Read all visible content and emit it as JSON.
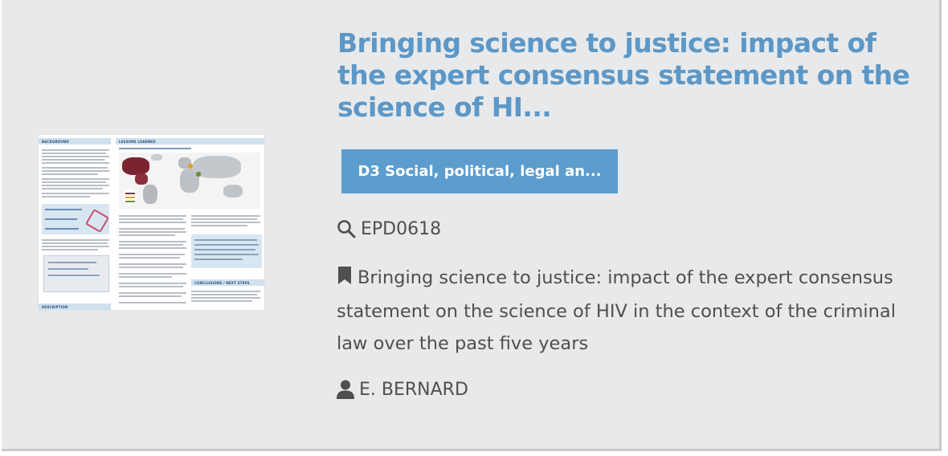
{
  "card": {
    "title": "Bringing science to justice: impact of the expert consensus statement on the science of HI...",
    "tag_label": "D3 Social, political, legal an...",
    "code": "EPD0618",
    "description": "Bringing science to justice: impact of the expert consensus statement on the science of HIV in the context of the criminal law over the past five years",
    "author": "E. BERNARD",
    "icons": {
      "code": "search-icon",
      "description": "bookmark-icon",
      "author": "user-icon"
    },
    "colors": {
      "title": "#5c98c7",
      "tag_background": "#5c9dcd",
      "card_background": "#e8e9eb",
      "text": "#4f4f4f"
    }
  },
  "poster": {
    "section_background": "BACKGROUND",
    "section_lessons": "LESSONS LEARNED",
    "section_description": "DESCRIPTION",
    "section_conclusions": "CONCLUSIONS / NEXT STEPS"
  }
}
